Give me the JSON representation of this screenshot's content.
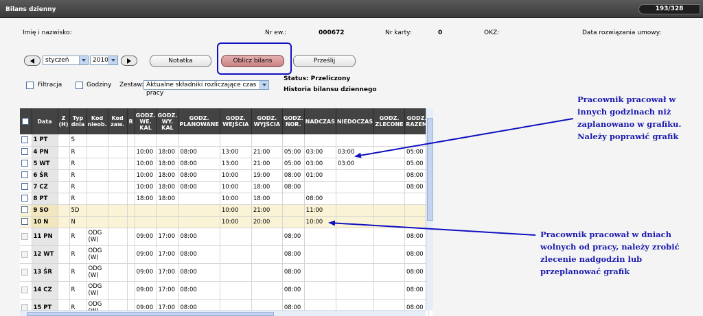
{
  "window": {
    "title": "Bilans dzienny",
    "pager": "193/328"
  },
  "employee": {
    "name_label": "Imię i nazwisko:",
    "nr_ew_label": "Nr ew.:",
    "nr_ew_value": "000672",
    "card_label": "Nr karty:",
    "card_value": "0",
    "okz_label": "OKZ:",
    "termination_label": "Data rozwiązania umowy:"
  },
  "controls": {
    "month": "styczeń",
    "year": "2010",
    "notatka": "Notatka",
    "oblicz": "Oblicz bilans",
    "przeslij": "Prześlij",
    "filtracja": "Filtracja",
    "godziny": "Godziny",
    "zestaw_label": "Zestaw:",
    "zestaw_value": "Aktualne składniki rozliczające czas pracy",
    "status": "Status: Przeliczony",
    "history": "Historia bilansu dziennego"
  },
  "table": {
    "headers": [
      "Data",
      "Z (H)",
      "Typ dnia",
      "Kod nieob.",
      "Kod zaw.",
      "R",
      "GODZ. WE. KAL",
      "GODZ. WY. KAL",
      "GODZ. PLANOWANE",
      "GODZ. WEJŚCIA",
      "GODZ. WYJŚCIA",
      "GODZ. NOR.",
      "NADCZAS",
      "NIEDOCZAS",
      "GODZ. ZLECONE",
      "GODZ. RAZEM"
    ],
    "rows": [
      [
        "1 PT",
        "",
        "S",
        "",
        "",
        "",
        "",
        "",
        "",
        "",
        "",
        "",
        "",
        "",
        "",
        ""
      ],
      [
        "4 PN",
        "",
        "R",
        "",
        "",
        "",
        "10:00",
        "18:00",
        "08:00",
        "13:00",
        "21:00",
        "05:00",
        "03:00",
        "03:00",
        "",
        "05:00"
      ],
      [
        "5 WT",
        "",
        "R",
        "",
        "",
        "",
        "10:00",
        "18:00",
        "08:00",
        "13:00",
        "21:00",
        "05:00",
        "03:00",
        "03:00",
        "",
        "05:00"
      ],
      [
        "6 ŚR",
        "",
        "R",
        "",
        "",
        "",
        "10:00",
        "18:00",
        "08:00",
        "10:00",
        "19:00",
        "08:00",
        "01:00",
        "",
        "",
        "08:00"
      ],
      [
        "7 CZ",
        "",
        "R",
        "",
        "",
        "",
        "10:00",
        "18:00",
        "08:00",
        "10:00",
        "18:00",
        "08:00",
        "",
        "",
        "",
        "08:00"
      ],
      [
        "8 PT",
        "",
        "R",
        "",
        "",
        "",
        "18:00",
        "18:00",
        "",
        "10:00",
        "18:00",
        "",
        "08:00",
        "",
        "",
        ""
      ],
      [
        "9 SO",
        "",
        "5D",
        "",
        "",
        "",
        "",
        "",
        "",
        "10:00",
        "21:00",
        "",
        "11:00",
        "",
        "",
        ""
      ],
      [
        "10 N",
        "",
        "N",
        "",
        "",
        "",
        "",
        "",
        "",
        "10:00",
        "20:00",
        "",
        "10:00",
        "",
        "",
        ""
      ],
      [
        "11 PN",
        "",
        "R",
        "ODG (W)",
        "",
        "",
        "09:00",
        "17:00",
        "08:00",
        "",
        "",
        "08:00",
        "",
        "",
        "",
        "08:00"
      ],
      [
        "12 WT",
        "",
        "R",
        "ODG (W)",
        "",
        "",
        "09:00",
        "17:00",
        "08:00",
        "",
        "",
        "08:00",
        "",
        "",
        "",
        "08:00"
      ],
      [
        "13 ŚR",
        "",
        "R",
        "ODG (W)",
        "",
        "",
        "09:00",
        "17:00",
        "08:00",
        "",
        "",
        "08:00",
        "",
        "",
        "",
        "08:00"
      ],
      [
        "14 CZ",
        "",
        "R",
        "ODG (W)",
        "",
        "",
        "09:00",
        "17:00",
        "08:00",
        "",
        "",
        "08:00",
        "",
        "",
        "",
        "08:00"
      ],
      [
        "15 PT",
        "",
        "R",
        "ODG (W)",
        "",
        "",
        "09:00",
        "17:00",
        "08:00",
        "",
        "",
        "08:00",
        "",
        "",
        "",
        "08:00"
      ]
    ]
  },
  "annotations": {
    "a1": [
      "Pracownik pracował w",
      "innych godzinach niż",
      "zaplanowano w grafiku.",
      "Należy poprawić grafik"
    ],
    "a2": [
      "Pracownik pracował w dniach",
      "wolnych od pracy, należy zrobić",
      "zlecenie nadgodzin lub",
      "przeplanować grafik"
    ]
  }
}
